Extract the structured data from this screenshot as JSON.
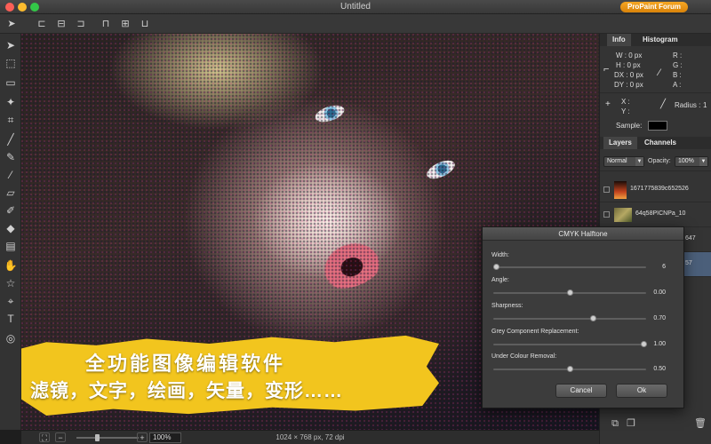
{
  "window": {
    "title": "Untitled",
    "forum_button": "ProPaint Forum"
  },
  "option_toolbar": {
    "icons": [
      "move-arrow-icon",
      "align-left-icon",
      "align-center-icon",
      "align-right-icon",
      "align-top-icon",
      "align-middle-icon",
      "align-bottom-icon"
    ]
  },
  "tools": [
    "move-icon",
    "transform-icon",
    "marquee-icon",
    "magic-wand-icon",
    "crop-icon",
    "brush-icon",
    "pencil-icon",
    "eyedropper-icon",
    "eraser-icon",
    "paint-icon",
    "fill-icon",
    "gradient-icon",
    "hand-icon",
    "star-icon",
    "path-icon",
    "text-icon",
    "zoom-icon"
  ],
  "banner": {
    "line1": "全功能图像编辑软件",
    "line2": "滤镜，文字，绘画，矢量，变形……"
  },
  "info_panel": {
    "tabs": [
      "Info",
      "Histogram"
    ],
    "w": "W : 0 px",
    "h": "H : 0 px",
    "dx": "DX : 0 px",
    "dy": "DY : 0 px",
    "r": "R :",
    "g": "G :",
    "b": "B :",
    "a": "A :",
    "x": "X :",
    "y": "Y :",
    "radius_label": "Radius :",
    "radius_value": "1",
    "sample_label": "Sample:",
    "sample_color": "#000000"
  },
  "layers_panel": {
    "tabs": [
      "Layers",
      "Channels"
    ],
    "blend_mode": "Normal",
    "opacity_label": "Opacity:",
    "opacity_value": "100%",
    "layers": [
      {
        "name": "1671775839c652526"
      },
      {
        "name": "64q58PICNPa_10"
      },
      {
        "name": "647"
      },
      {
        "name": "57"
      }
    ]
  },
  "status_bar": {
    "zoom": "100%",
    "doc_info": "1024 × 768 px, 72 dpi",
    "zoom_level": 0.3
  },
  "dialog": {
    "title": "CMYK Halftone",
    "params": [
      {
        "label": "Width:",
        "value": "6",
        "fraction": 0.02
      },
      {
        "label": "Angle:",
        "value": "0.00",
        "fraction": 0.5
      },
      {
        "label": "Sharpness:",
        "value": "0.70",
        "fraction": 0.65
      },
      {
        "label": "Grey Component Replacement:",
        "value": "1.00",
        "fraction": 0.98
      },
      {
        "label": "Under Colour Removal:",
        "value": "0.50",
        "fraction": 0.5
      }
    ],
    "cancel": "Cancel",
    "ok": "Ok"
  },
  "colors": {
    "accent": "#f6a623",
    "banner": "#f2c51e",
    "selected_layer": "#4b5f7a"
  }
}
